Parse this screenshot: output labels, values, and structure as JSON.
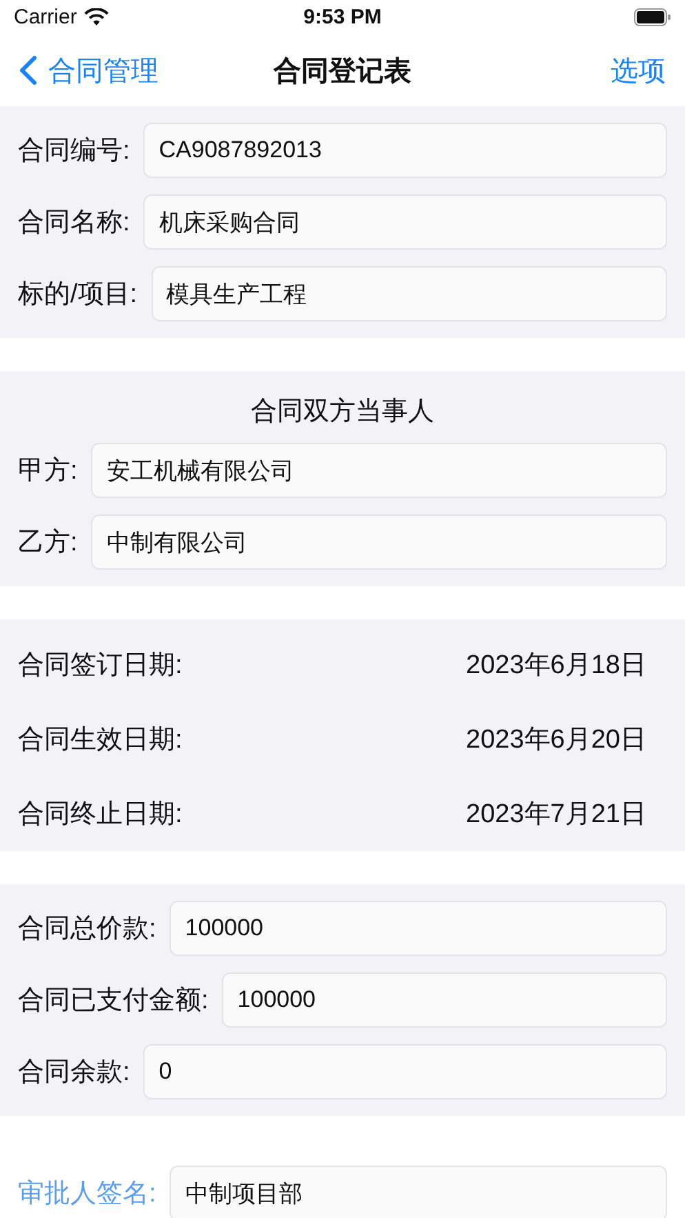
{
  "status_bar": {
    "carrier": "Carrier",
    "time": "9:53 PM"
  },
  "nav": {
    "back": "合同管理",
    "title": "合同登记表",
    "action": "选项"
  },
  "sections": [
    {
      "rows": [
        {
          "kind": "field",
          "label": "合同编号:",
          "value": "CA9087892013"
        },
        {
          "kind": "field",
          "label": "合同名称:",
          "value": "机床采购合同"
        },
        {
          "kind": "field",
          "label": "标的/项目:",
          "value": "模具生产工程"
        }
      ]
    },
    {
      "heading": "合同双方当事人",
      "rows": [
        {
          "kind": "field",
          "label": "甲方:",
          "value": "安工机械有限公司"
        },
        {
          "kind": "field",
          "label": "乙方:",
          "value": "中制有限公司"
        }
      ]
    },
    {
      "rows": [
        {
          "kind": "date",
          "label": "合同签订日期:",
          "value": "2023年6月18日"
        },
        {
          "kind": "date",
          "label": "合同生效日期:",
          "value": "2023年6月20日"
        },
        {
          "kind": "date",
          "label": "合同终止日期:",
          "value": "2023年7月21日"
        }
      ]
    },
    {
      "rows": [
        {
          "kind": "field",
          "label": "合同总价款:",
          "value": "100000"
        },
        {
          "kind": "field",
          "label": "合同已支付金额:",
          "value": "100000"
        },
        {
          "kind": "field",
          "label": "合同余款:",
          "value": "0"
        }
      ]
    }
  ],
  "signature": {
    "label": "审批人签名:",
    "value": "中制项目部"
  }
}
